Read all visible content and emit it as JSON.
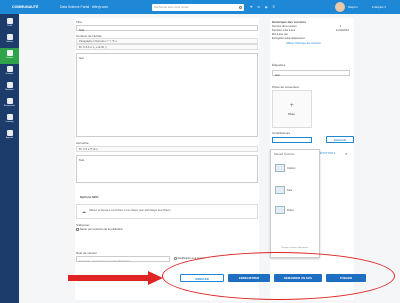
{
  "topbar": {
    "brand": "COMMUNAUTÉ",
    "crumb": "Data Science Portal · Afterjv.com",
    "search_placeholder": "Recherche dans votre portail",
    "icons": "⚑ ✉ ◉ ☰",
    "user": "Stephn",
    "language": "Français ▾"
  },
  "sidebar": {
    "items": [
      {
        "label": "Profil"
      },
      {
        "label": "Tableau"
      },
      {
        "label": "Contenu"
      },
      {
        "label": "Groupes"
      },
      {
        "label": "Membres"
      },
      {
        "label": "Événements"
      },
      {
        "label": "Learning"
      },
      {
        "label": "Agenda"
      }
    ]
  },
  "form": {
    "title_label": "Titre",
    "title_value": "Test",
    "content_label": "Contenu de l'article",
    "toolbar_row1": "Paragraphe ▾  Normal ▾  ↶ ↷  ☰ ≡",
    "toolbar_row2": "B  I  U  S  A  x²  x₂  ≡  ⊞  ⌧  ⟨⟩",
    "content_value": "test",
    "accroche_label": "Accroche",
    "accroche_toolbar": "B  I  U  S  ≡  ☰  ⊞  ⟨⟩",
    "accroche_value": "Test",
    "seo_label": "Options SEO",
    "seo_text": "Glissez et déposez vos fichiers ici ou cliquez pour télécharger des fichiers",
    "alerter_label": "S'abonner",
    "alerter_text": "Alerter par email lors de la publication",
    "note_label": "Note de version",
    "note_placeholder": "Exemple : ajout d'une nouvelle illustration",
    "modif_text": "Modification à la légère"
  },
  "right": {
    "history_label": "Historique des versions",
    "version_label": "Numéro de la version",
    "version_value": "1",
    "date_label": "Dernière mise à jour",
    "date_value": "11/12/2023",
    "schedule_label": "Mis à jour par",
    "auto_label": "Enregistré automatiquement",
    "history_link": "Afficher l'historique des révisions",
    "tags_label": "Étiquettes",
    "tags_value": "test",
    "photo_label": "Photo de couverture",
    "photo_btn": "Photo",
    "contrib_label": "Contributeurs",
    "contrib_btn": "Autoriser",
    "contrib_extra": "R/TUTTOR ▾"
  },
  "dropdown": {
    "header": "Dassault Systèmes",
    "items": [
      {
        "name": "Chatbot"
      },
      {
        "name": "Data"
      },
      {
        "name": "Bodax"
      }
    ],
    "footer": "Charger d'autres utilisateurs"
  },
  "actions": {
    "cancel": "ANNULER",
    "save": "ENREGISTRER",
    "request": "DEMANDER UN AVIS",
    "publish": "PUBLIER"
  },
  "colors": {
    "topbar": "#1e88d6",
    "sidebar": "#1c3d6c",
    "active": "#2fa34a",
    "annotation": "#e02424"
  }
}
